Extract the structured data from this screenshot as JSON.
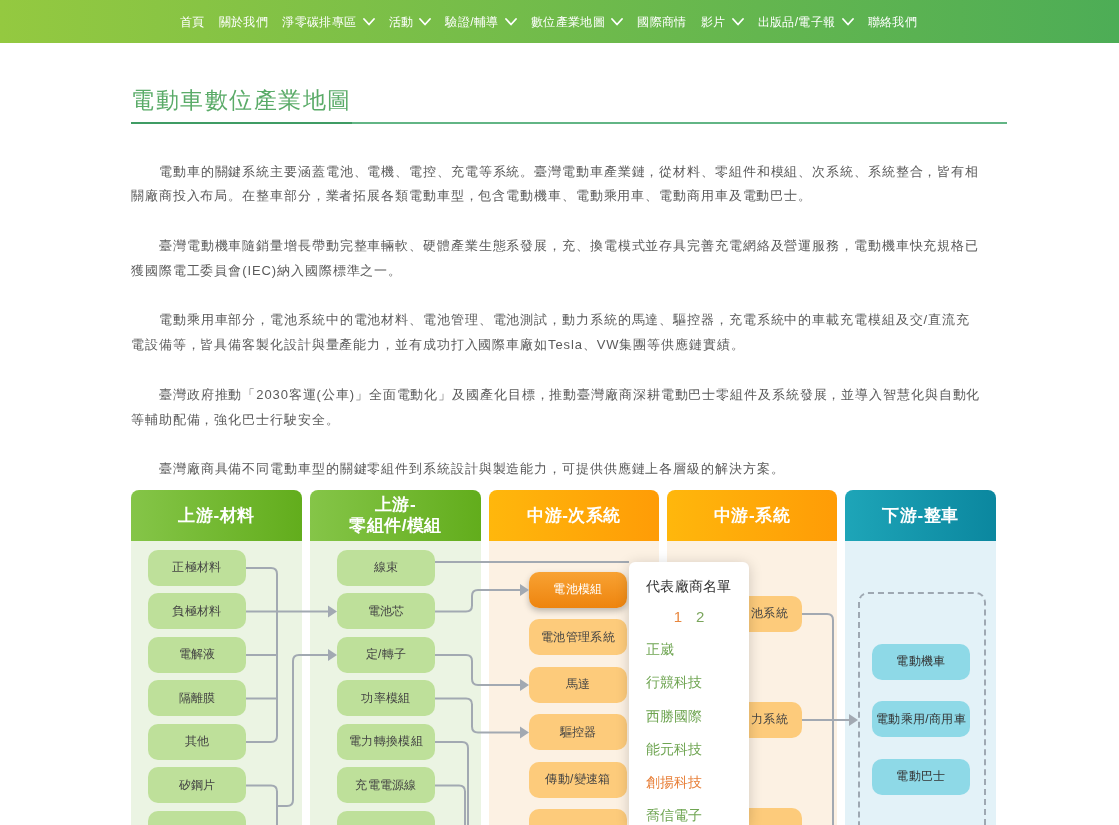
{
  "nav": {
    "items": [
      {
        "label": "首頁",
        "has_menu": false
      },
      {
        "label": "關於我們",
        "has_menu": false
      },
      {
        "label": "淨零碳排專區",
        "has_menu": true
      },
      {
        "label": "活動",
        "has_menu": true
      },
      {
        "label": "驗證/輔導",
        "has_menu": true
      },
      {
        "label": "數位產業地圖",
        "has_menu": true
      },
      {
        "label": "國際商情",
        "has_menu": false
      },
      {
        "label": "影片",
        "has_menu": true
      },
      {
        "label": "出版品/電子報",
        "has_menu": true
      },
      {
        "label": "聯絡我們",
        "has_menu": false
      }
    ]
  },
  "article": {
    "title": "電動車數位產業地圖",
    "paragraphs": [
      [
        "電動車的關鍵系統主要涵蓋電池、電機、電控、充電等系統。臺灣電動車產業鏈，從材料、零組件和模組、次系統、系統整合，皆有相",
        "關廠商投入布局。在整車部分，業者拓展各類電動車型，包含電動機車、電動乘用車、電動商用車及電動巴士。"
      ],
      [
        "臺灣電動機車隨銷量增長帶動完整車輛軟、硬體產業生態系發展，充、換電模式並存具完善充電網絡及營運服務，電動機車快充規格已",
        "獲國際電工委員會(IEC)納入國際標準之一。"
      ],
      [
        "電動乘用車部分，電池系統中的電池材料、電池管理、電池測試，動力系統的馬達、驅控器，充電系統中的車載充電模組及交/直流充",
        "電設備等，皆具備客製化設計與量產能力，並有成功打入國際車廠如Tesla、VW集團等供應鏈實績。"
      ],
      [
        "臺灣政府推動「2030客運(公車)」全面電動化」及國產化目標，推動臺灣廠商深耕電動巴士零組件及系統發展，並導入智慧化與自動化",
        "等輔助配備，強化巴士行駛安全。"
      ],
      [
        "臺灣廠商具備不同電動車型的關鍵零組件到系統設計與製造能力，可提供供應鏈上各層級的解決方案。"
      ]
    ]
  },
  "diagram": {
    "columns": [
      {
        "title": "上游-材料",
        "kind": "upstream",
        "framed": false,
        "cut_node": true,
        "nodes": [
          {
            "label": "正極材料",
            "selected": false
          },
          {
            "label": "負極材料",
            "selected": false
          },
          {
            "label": "電解液",
            "selected": false
          },
          {
            "label": "隔離膜",
            "selected": false
          },
          {
            "label": "其他",
            "selected": false
          },
          {
            "label": "矽鋼片",
            "selected": false
          }
        ]
      },
      {
        "title": "上游-\n零組件/模組",
        "kind": "upstream",
        "framed": false,
        "cut_node": true,
        "nodes": [
          {
            "label": "線束",
            "selected": false
          },
          {
            "label": "電池芯",
            "selected": false
          },
          {
            "label": "定/轉子",
            "selected": false
          },
          {
            "label": "功率模組",
            "selected": false
          },
          {
            "label": "電力轉換模組",
            "selected": false
          },
          {
            "label": "充電電源線",
            "selected": false
          }
        ]
      },
      {
        "title": "中游-次系統",
        "kind": "midstream",
        "framed": false,
        "cut_node": true,
        "nodes": [
          {
            "label": "電池模組",
            "selected": true
          },
          {
            "label": "電池管理系統",
            "selected": false
          },
          {
            "label": "馬達",
            "selected": false
          },
          {
            "label": "驅控器",
            "selected": false
          },
          {
            "label": "傳動/變速箱",
            "selected": false
          }
        ]
      },
      {
        "title": "中游-系統",
        "kind": "midstream",
        "framed": false,
        "cut_node": true,
        "nodes": [
          {
            "label": "池系統",
            "selected": false
          },
          {
            "label": "力系統",
            "selected": false
          }
        ]
      },
      {
        "title": "下游-整車",
        "kind": "downstream",
        "framed": true,
        "cut_node": false,
        "nodes": [
          {
            "label": "電動機車",
            "selected": false
          },
          {
            "label": "電動乘用/商用車",
            "selected": false
          },
          {
            "label": "電動巴士",
            "selected": false
          }
        ]
      }
    ],
    "popup": {
      "title": "代表廠商名單",
      "pages": [
        {
          "label": "1",
          "selected": true
        },
        {
          "label": "2",
          "selected": false
        }
      ],
      "vendors": [
        {
          "name": "正崴",
          "selected": false
        },
        {
          "name": "行競科技",
          "selected": false
        },
        {
          "name": "西勝國際",
          "selected": false
        },
        {
          "name": "能元科技",
          "selected": false
        },
        {
          "name": "創揚科技",
          "selected": true
        },
        {
          "name": "喬信電子",
          "selected": false
        }
      ]
    }
  }
}
